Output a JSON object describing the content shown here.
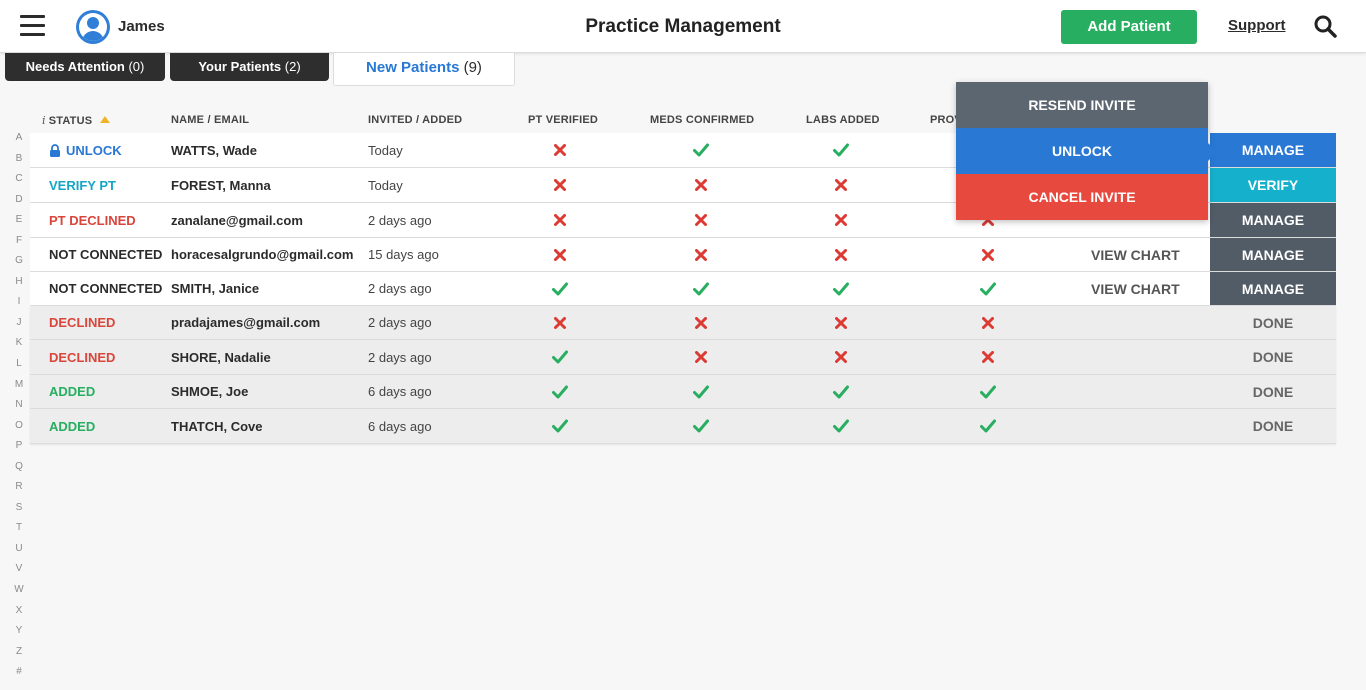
{
  "header": {
    "user_name": "James",
    "title": "Practice Management",
    "add_patient_label": "Add Patient",
    "support_label": "Support"
  },
  "tabs": [
    {
      "label": "Needs Attention",
      "count": "(0)"
    },
    {
      "label": "Your Patients",
      "count": "(2)"
    },
    {
      "label": "New Patients",
      "count": "(9)"
    }
  ],
  "alphabet": [
    "A",
    "B",
    "C",
    "D",
    "E",
    "F",
    "G",
    "H",
    "I",
    "J",
    "K",
    "L",
    "M",
    "N",
    "O",
    "P",
    "Q",
    "R",
    "S",
    "T",
    "U",
    "V",
    "W",
    "X",
    "Y",
    "Z",
    "#"
  ],
  "columns": {
    "info": "i",
    "status": "STATUS",
    "name": "NAME / EMAIL",
    "invited": "INVITED / ADDED",
    "pt_verified": "PT VERIFIED",
    "meds_confirmed": "MEDS CONFIRMED",
    "labs_added": "LABS ADDED",
    "provider": "PROV"
  },
  "colors": {
    "blue": "#2878d4",
    "teal": "#15a6c4",
    "red": "#d9453b",
    "green": "#27ae60",
    "dark": "#2b2b2b",
    "slate": "#525c66",
    "check": "#27ae60",
    "cross": "#dc3b34"
  },
  "popup": {
    "resend_label": "RESEND INVITE",
    "unlock_label": "UNLOCK",
    "cancel_label": "CANCEL INVITE"
  },
  "rows": [
    {
      "status": "UNLOCK",
      "status_color": "blue",
      "locked": true,
      "name": "WATTS, Wade",
      "date": "Today",
      "marks": [
        false,
        true,
        true,
        null
      ],
      "chart": "",
      "action": "MANAGE",
      "action_style": "blue",
      "row_style": "white"
    },
    {
      "status": "VERIFY PT",
      "status_color": "teal",
      "locked": false,
      "name": "FOREST, Manna",
      "date": "Today",
      "marks": [
        false,
        false,
        false,
        null
      ],
      "chart": "",
      "action": "VERIFY",
      "action_style": "teal",
      "row_style": "white"
    },
    {
      "status": "PT DECLINED",
      "status_color": "red",
      "locked": false,
      "name": "zanalane@gmail.com",
      "date": "2 days ago",
      "marks": [
        false,
        false,
        false,
        false
      ],
      "chart": "",
      "action": "MANAGE",
      "action_style": "slate",
      "row_style": "white"
    },
    {
      "status": "NOT CONNECTED",
      "status_color": "dark",
      "locked": false,
      "name": "horacesalgrundo@gmail.com",
      "date": "15 days ago",
      "marks": [
        false,
        false,
        false,
        false
      ],
      "chart": "VIEW CHART",
      "action": "MANAGE",
      "action_style": "slate",
      "row_style": "white"
    },
    {
      "status": "NOT CONNECTED",
      "status_color": "dark",
      "locked": false,
      "name": "SMITH, Janice",
      "date": "2 days ago",
      "marks": [
        true,
        true,
        true,
        true
      ],
      "chart": "VIEW CHART",
      "action": "MANAGE",
      "action_style": "slate",
      "row_style": "white"
    },
    {
      "status": "DECLINED",
      "status_color": "red",
      "locked": false,
      "name": "pradajames@gmail.com",
      "date": "2 days ago",
      "marks": [
        false,
        false,
        false,
        false
      ],
      "chart": "",
      "action": "DONE",
      "action_style": "done",
      "row_style": "grey"
    },
    {
      "status": "DECLINED",
      "status_color": "red",
      "locked": false,
      "name": "SHORE, Nadalie",
      "date": "2 days ago",
      "marks": [
        true,
        false,
        false,
        false
      ],
      "chart": "",
      "action": "DONE",
      "action_style": "done",
      "row_style": "grey"
    },
    {
      "status": "ADDED",
      "status_color": "green",
      "locked": false,
      "name": "SHMOE, Joe",
      "date": "6 days ago",
      "marks": [
        true,
        true,
        true,
        true
      ],
      "chart": "",
      "action": "DONE",
      "action_style": "done",
      "row_style": "grey"
    },
    {
      "status": "ADDED",
      "status_color": "green",
      "locked": false,
      "name": "THATCH, Cove",
      "date": "6 days ago",
      "marks": [
        true,
        true,
        true,
        true
      ],
      "chart": "",
      "action": "DONE",
      "action_style": "done",
      "row_style": "grey"
    }
  ]
}
